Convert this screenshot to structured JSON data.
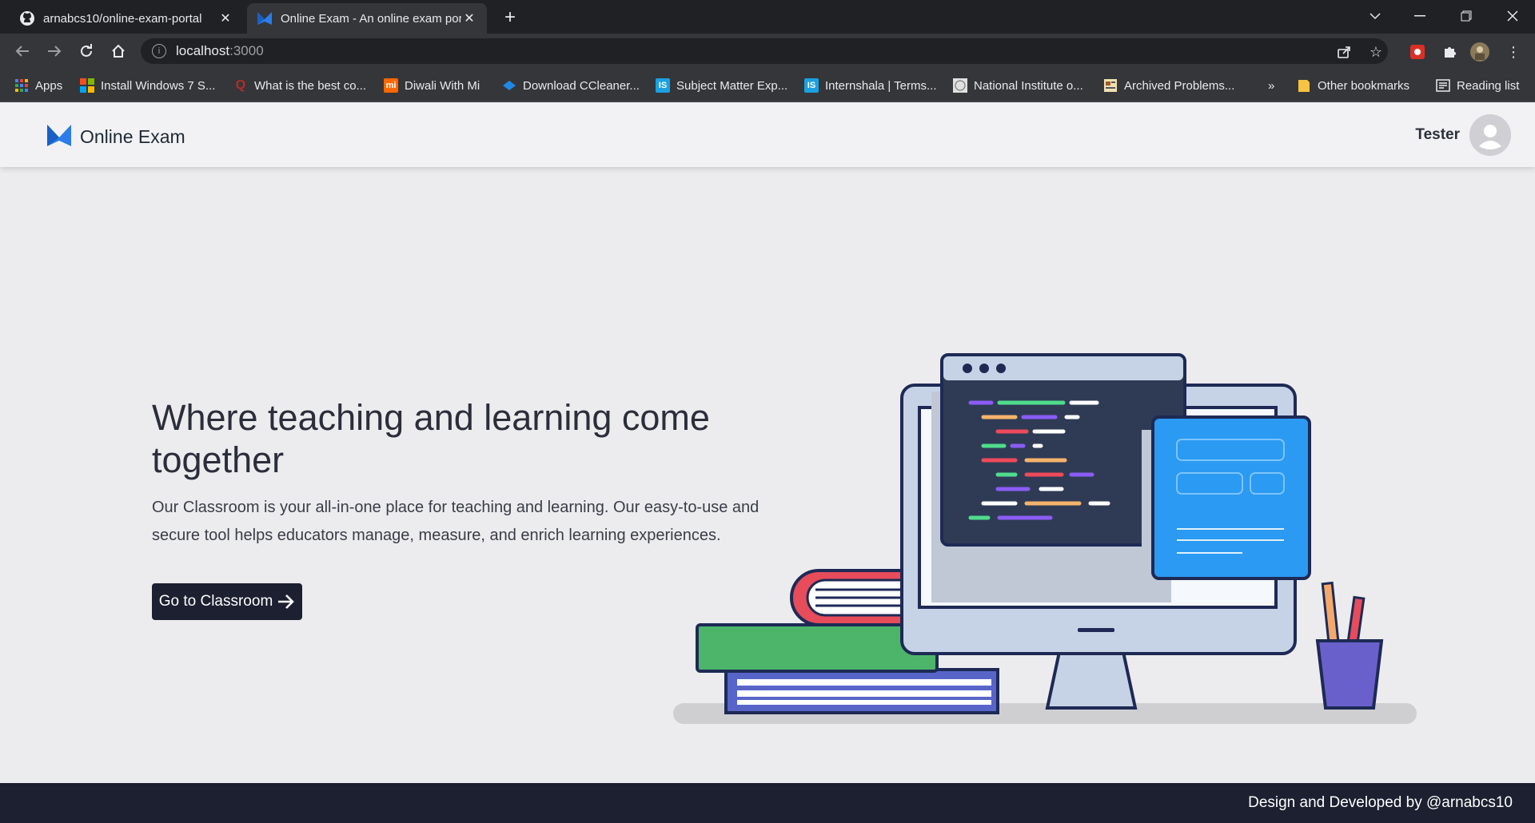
{
  "browser": {
    "tabs": [
      {
        "title": "arnabcs10/online-exam-portal",
        "favicon": "github-icon",
        "active": false
      },
      {
        "title": "Online Exam - An online exam portal",
        "favicon": "online-exam-logo-icon",
        "active": true
      }
    ],
    "address": {
      "host": "localhost",
      "port": ":3000"
    },
    "bookmarks": [
      {
        "label": "Apps",
        "icon": "apps-grid-icon"
      },
      {
        "label": "Install Windows 7 S...",
        "icon": "windows-icon"
      },
      {
        "label": "What is the best co...",
        "icon": "quora-icon"
      },
      {
        "label": "Diwali With Mi",
        "icon": "mi-icon"
      },
      {
        "label": "Download CCleaner...",
        "icon": "ccleaner-icon"
      },
      {
        "label": "Subject Matter Exp...",
        "icon": "internshala-icon"
      },
      {
        "label": "Internshala | Terms...",
        "icon": "internshala-icon"
      },
      {
        "label": "National Institute o...",
        "icon": "nit-icon"
      },
      {
        "label": "Archived Problems...",
        "icon": "page-icon"
      },
      {
        "label": "»",
        "icon": "more-bookmarks-icon"
      },
      {
        "label": "Other bookmarks",
        "icon": "folder-icon"
      },
      {
        "label": "Reading list",
        "icon": "reading-list-icon"
      }
    ]
  },
  "app": {
    "brand": "Online Exam",
    "user": "Tester"
  },
  "hero": {
    "title": "Where teaching and learning come together",
    "description": "Our Classroom is your all-in-one place for teaching and learning. Our easy-to-use and secure tool helps educators manage, measure, and enrich learning experiences.",
    "cta": "Go to Classroom"
  },
  "footer": {
    "text": "Design and Developed by @arnabcs10"
  },
  "colors": {
    "primary_dark": "#1c2030",
    "accent_blue": "#2b9af3",
    "page_bg": "#ececef"
  }
}
